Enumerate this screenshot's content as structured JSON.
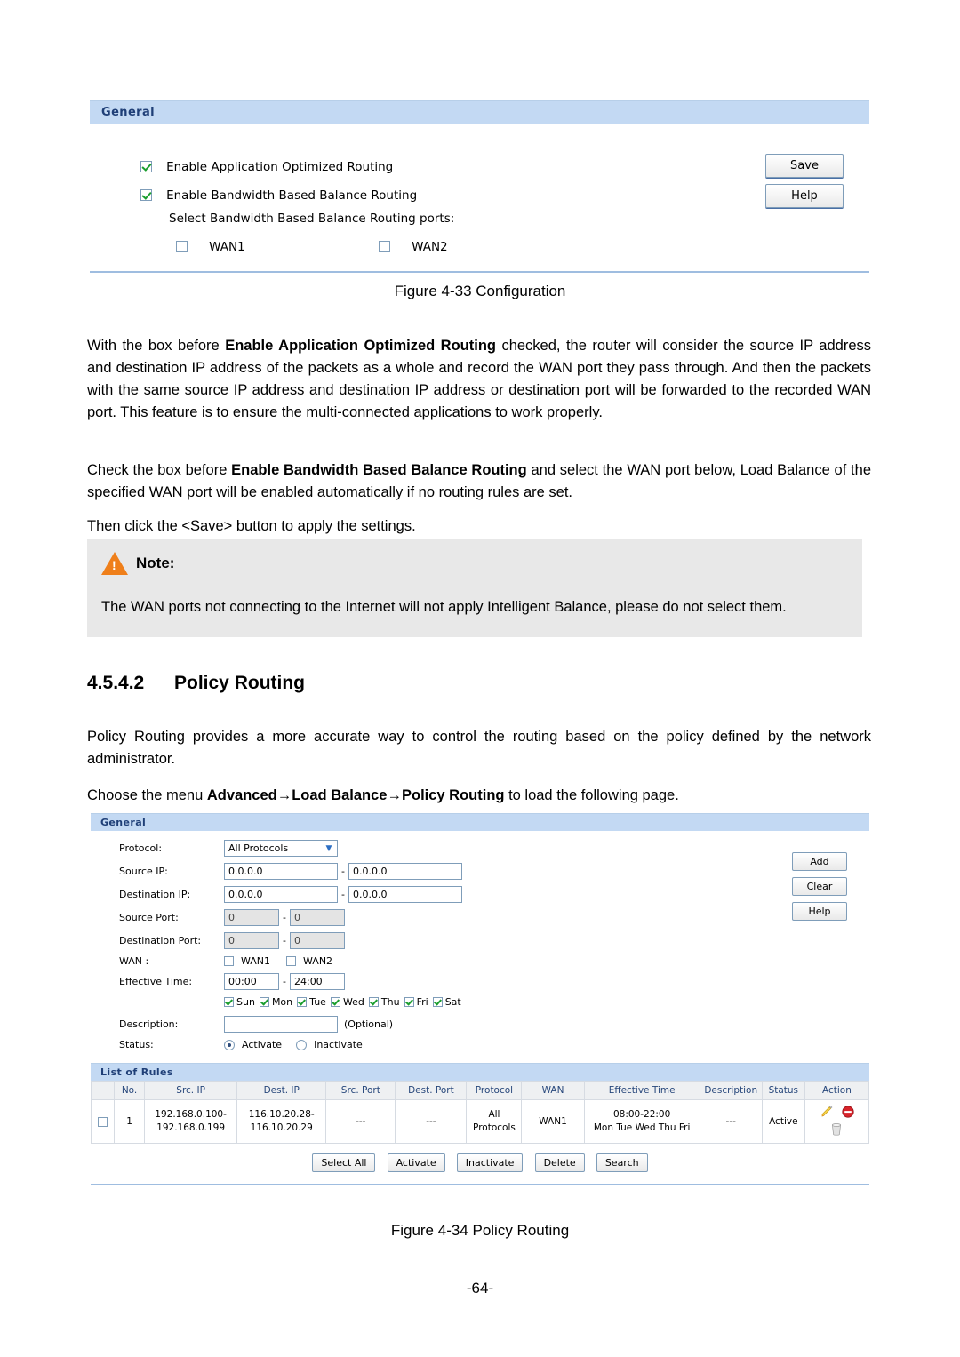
{
  "figure1": {
    "panel_title": "General",
    "checkboxes": [
      {
        "label": "Enable Application Optimized Routing",
        "checked": true
      },
      {
        "label": "Enable Bandwidth Based Balance Routing",
        "checked": true
      }
    ],
    "ports_hint": "Select Bandwidth Based Balance Routing ports:",
    "wan_ports": [
      {
        "label": "WAN1",
        "checked": false
      },
      {
        "label": "WAN2",
        "checked": false
      }
    ],
    "buttons": [
      "Save",
      "Help"
    ],
    "caption": "Figure 4-33 Configuration"
  },
  "body": {
    "para1_a": "With the box before ",
    "para1_b": "Enable Application Optimized Routing",
    "para1_c": " checked, the router will consider the source IP address and destination IP address of the packets as a whole and record the WAN port they pass through. And then the packets with the same source IP address and destination IP address or destination port will be forwarded to the recorded WAN port. This feature is to ensure the multi-connected applications to work properly.",
    "para2_a": "Check the box before ",
    "para2_b": "Enable Bandwidth Based Balance Routing",
    "para2_c": " and select the WAN port below, Load Balance of the specified WAN port will be enabled automatically if no routing rules are set.",
    "para3": "Then click the <Save> button to apply the settings.",
    "note_title": "Note:",
    "note_text": "The WAN ports not connecting to the Internet will not apply Intelligent Balance, please do not select them.",
    "heading_number": "4.5.4.2",
    "heading_title": "Policy Routing",
    "para4": "Policy Routing provides a more accurate way to control the routing based on the policy defined by the network administrator.",
    "para5_a": "Choose the menu ",
    "para5_b": "Advanced→Load Balance→Policy Routing",
    "para5_c": " to load the following page.",
    "page_number": "-64-"
  },
  "figure2": {
    "panel_title": "General",
    "form": {
      "protocol": {
        "label": "Protocol:",
        "value": "All Protocols"
      },
      "source_ip": {
        "label": "Source IP:",
        "from": "0.0.0.0",
        "to": "0.0.0.0"
      },
      "destination_ip": {
        "label": "Destination IP:",
        "from": "0.0.0.0",
        "to": "0.0.0.0"
      },
      "source_port": {
        "label": "Source Port:",
        "from": "0",
        "to": "0",
        "disabled": true
      },
      "destination_port": {
        "label": "Destination Port:",
        "from": "0",
        "to": "0",
        "disabled": true
      },
      "wan": {
        "label": "WAN :",
        "ports": [
          {
            "label": "WAN1",
            "checked": false
          },
          {
            "label": "WAN2",
            "checked": false
          }
        ]
      },
      "effective_time": {
        "label": "Effective Time:",
        "from": "00:00",
        "to": "24:00"
      },
      "weekdays": [
        {
          "label": "Sun",
          "checked": true
        },
        {
          "label": "Mon",
          "checked": true
        },
        {
          "label": "Tue",
          "checked": true
        },
        {
          "label": "Wed",
          "checked": true
        },
        {
          "label": "Thu",
          "checked": true
        },
        {
          "label": "Fri",
          "checked": true
        },
        {
          "label": "Sat",
          "checked": true
        }
      ],
      "description": {
        "label": "Description:",
        "value": "",
        "hint": "(Optional)"
      },
      "status": {
        "label": "Status:",
        "options": [
          {
            "label": "Activate",
            "selected": true
          },
          {
            "label": "Inactivate",
            "selected": false
          }
        ]
      }
    },
    "side_buttons": [
      "Add",
      "Clear",
      "Help"
    ],
    "list_title": "List of Rules",
    "table": {
      "headers": [
        "",
        "No.",
        "Src. IP",
        "Dest. IP",
        "Src. Port",
        "Dest. Port",
        "Protocol",
        "WAN",
        "Effective Time",
        "Description",
        "Status",
        "Action"
      ],
      "rows": [
        {
          "selected": false,
          "no": "1",
          "src_ip_line1": "192.168.0.100-",
          "src_ip_line2": "192.168.0.199",
          "dest_ip_line1": "116.10.20.28-",
          "dest_ip_line2": "116.10.20.29",
          "src_port": "---",
          "dest_port": "---",
          "protocol_line1": "All",
          "protocol_line2": "Protocols",
          "wan": "WAN1",
          "eff_time_line1": "08:00-22:00",
          "eff_time_line2": "Mon Tue Wed Thu Fri",
          "description": "---",
          "status": "Active",
          "actions": [
            "edit-icon",
            "inactivate-icon",
            "delete-icon"
          ]
        }
      ]
    },
    "footer_buttons": [
      "Select All",
      "Activate",
      "Inactivate",
      "Delete",
      "Search"
    ],
    "caption": "Figure 4-34 Policy Routing"
  },
  "colors": {
    "panel_header_bg": "#c3d9f3",
    "panel_header_text": "#1f3f77",
    "table_header_bg": "#eef0f2",
    "table_header_text": "#27477b",
    "note_bg": "#e8e8e8",
    "warn_orange": "#ef7f1a",
    "check_green": "#1a9e2e",
    "edit_yellow": "#f3c220",
    "forbid_red": "#d8232a"
  }
}
